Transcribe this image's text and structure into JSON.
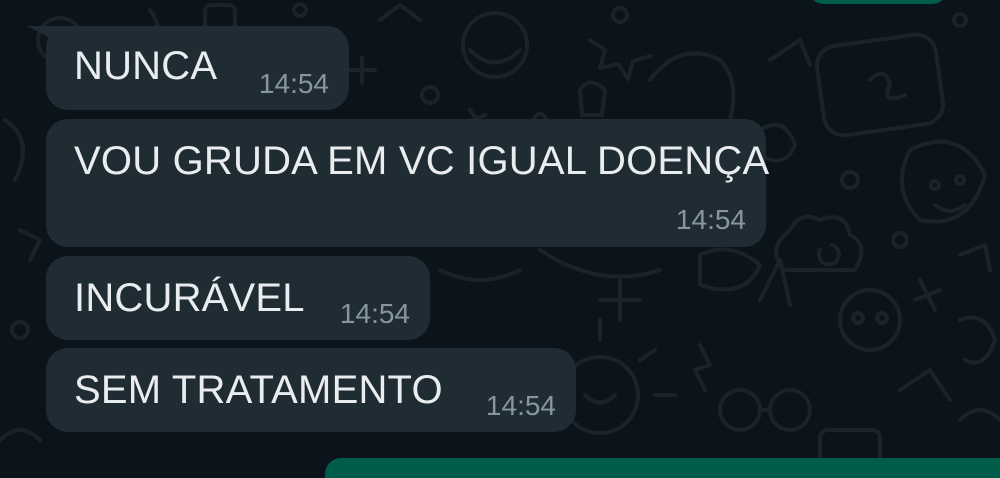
{
  "chat": {
    "messages": [
      {
        "text": "NUNCA",
        "time": "14:54"
      },
      {
        "text": "VOU GRUDA EM VC IGUAL DOENÇA",
        "time": "14:54"
      },
      {
        "text": "INCURÁVEL",
        "time": "14:54"
      },
      {
        "text": "SEM TRATAMENTO",
        "time": "14:54"
      }
    ]
  },
  "colors": {
    "background": "#0b141a",
    "incoming_bubble": "#202c33",
    "outgoing_bubble": "#005c4b",
    "message_text": "#e9edef",
    "timestamp_text": "#8696a0"
  }
}
